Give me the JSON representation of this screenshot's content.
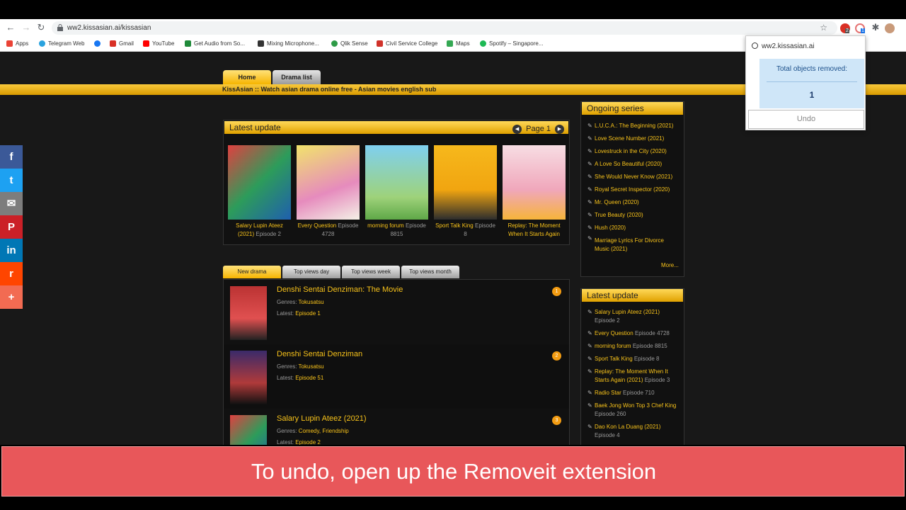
{
  "browser": {
    "url": "ww2.kissasian.ai/kissasian",
    "ext_badge_1": "2",
    "ext_badge_2": "1",
    "bookmarks": [
      {
        "label": "Apps",
        "icon": "apps-icon",
        "color": "#ea4335"
      },
      {
        "label": "Telegram Web",
        "icon": "telegram-icon",
        "color": "#2aa3df"
      },
      {
        "label": "",
        "icon": "facebook-icon",
        "color": "#1877f2"
      },
      {
        "label": "Gmail",
        "icon": "gmail-icon",
        "color": "#d93025"
      },
      {
        "label": "YouTube",
        "icon": "youtube-icon",
        "color": "#ff0000"
      },
      {
        "label": "Get Audio from So...",
        "icon": "audio-icon",
        "color": "#1f8a3a"
      },
      {
        "label": "Mixing Microphone...",
        "icon": "ms-icon",
        "color": "#333333"
      },
      {
        "label": "Qlik Sense",
        "icon": "qlik-icon",
        "color": "#2e9b47"
      },
      {
        "label": "Civil Service College",
        "icon": "csc-icon",
        "color": "#d0322a"
      },
      {
        "label": "Maps",
        "icon": "maps-icon",
        "color": "#34a853"
      },
      {
        "label": "Spotify – Singapore...",
        "icon": "spotify-icon",
        "color": "#1db954"
      }
    ]
  },
  "site": {
    "tabs": [
      "Home",
      "Drama list"
    ],
    "tagline": "KissAsian :: Watch asian drama online free - Asian movies english sub",
    "latest_update_title": "Latest update",
    "page_label": "Page 1",
    "thumbs": [
      {
        "title": "Salary Lupin Ateez (2021)",
        "ep": "Episode 2",
        "color": "#d63a3a"
      },
      {
        "title": "Every Question",
        "ep": "Episode 4728",
        "color": "#e8d84a"
      },
      {
        "title": "morning forum",
        "ep": "Episode 8815",
        "color": "#79c26a"
      },
      {
        "title": "Sport Talk King",
        "ep": "Episode 8",
        "color": "#f1b41f"
      },
      {
        "title": "Replay: The Moment When It Starts Again",
        "ep": "",
        "color": "#f2a5b4"
      }
    ],
    "list_tabs": [
      "New drama",
      "Top views day",
      "Top views week",
      "Top views month"
    ],
    "list": [
      {
        "title": "Denshi Sentai Denziman: The Movie",
        "genres": "Tokusatsu",
        "latest": "Episode 1",
        "num": "1",
        "color": "#c43b3b"
      },
      {
        "title": "Denshi Sentai Denziman",
        "genres": "Tokusatsu",
        "latest": "Episode 51",
        "num": "2",
        "color": "#7a2f8a"
      },
      {
        "title": "Salary Lupin Ateez (2021)",
        "genres": "Comedy, Friendship",
        "latest": "Episode 2",
        "num": "3",
        "color": "#d63a3a"
      }
    ],
    "genres_label": "Genres:",
    "latest_label": "Latest:",
    "ongoing_title": "Ongoing series",
    "ongoing": [
      "L.U.C.A.: The Beginning (2021)",
      "Love Scene Number (2021)",
      "Lovestruck in the City (2020)",
      "A Love So Beautiful (2020)",
      "She Would Never Know (2021)",
      "Royal Secret Inspector (2020)",
      "Mr. Queen (2020)",
      "True Beauty (2020)",
      "Hush (2020)",
      "Marriage Lyrics For Divorce Music (2021)"
    ],
    "more": "More...",
    "side_latest_title": "Latest update",
    "side_latest": [
      {
        "t": "Salary Lupin Ateez (2021)",
        "e": "Episode 2"
      },
      {
        "t": "Every Question",
        "e": "Episode 4728"
      },
      {
        "t": "morning forum",
        "e": "Episode 8815"
      },
      {
        "t": "Sport Talk King",
        "e": "Episode 8"
      },
      {
        "t": "Replay: The Moment When It Starts Again (2021)",
        "e": "Episode 3"
      },
      {
        "t": "Radio Star",
        "e": "Episode 710"
      },
      {
        "t": "Baek Jong Won Top 3 Chef King",
        "e": "Episode 260"
      },
      {
        "t": "Dao Kon La Duang (2021)",
        "e": "Episode 4"
      }
    ]
  },
  "social": [
    {
      "icon": "facebook-share-icon",
      "glyph": "f",
      "color": "#3b5998"
    },
    {
      "icon": "twitter-share-icon",
      "glyph": "t",
      "color": "#1da1f2"
    },
    {
      "icon": "email-share-icon",
      "glyph": "✉",
      "color": "#7d7d7d"
    },
    {
      "icon": "pinterest-share-icon",
      "glyph": "P",
      "color": "#cb2027"
    },
    {
      "icon": "linkedin-share-icon",
      "glyph": "in",
      "color": "#0077b5"
    },
    {
      "icon": "reddit-share-icon",
      "glyph": "r",
      "color": "#ff4500"
    },
    {
      "icon": "more-share-icon",
      "glyph": "+",
      "color": "#f26b52"
    }
  ],
  "popup": {
    "host": "ww2.kissasian.ai",
    "label": "Total objects removed:",
    "count": "1",
    "undo": "Undo"
  },
  "caption": "To undo, open up the Removeit extension"
}
